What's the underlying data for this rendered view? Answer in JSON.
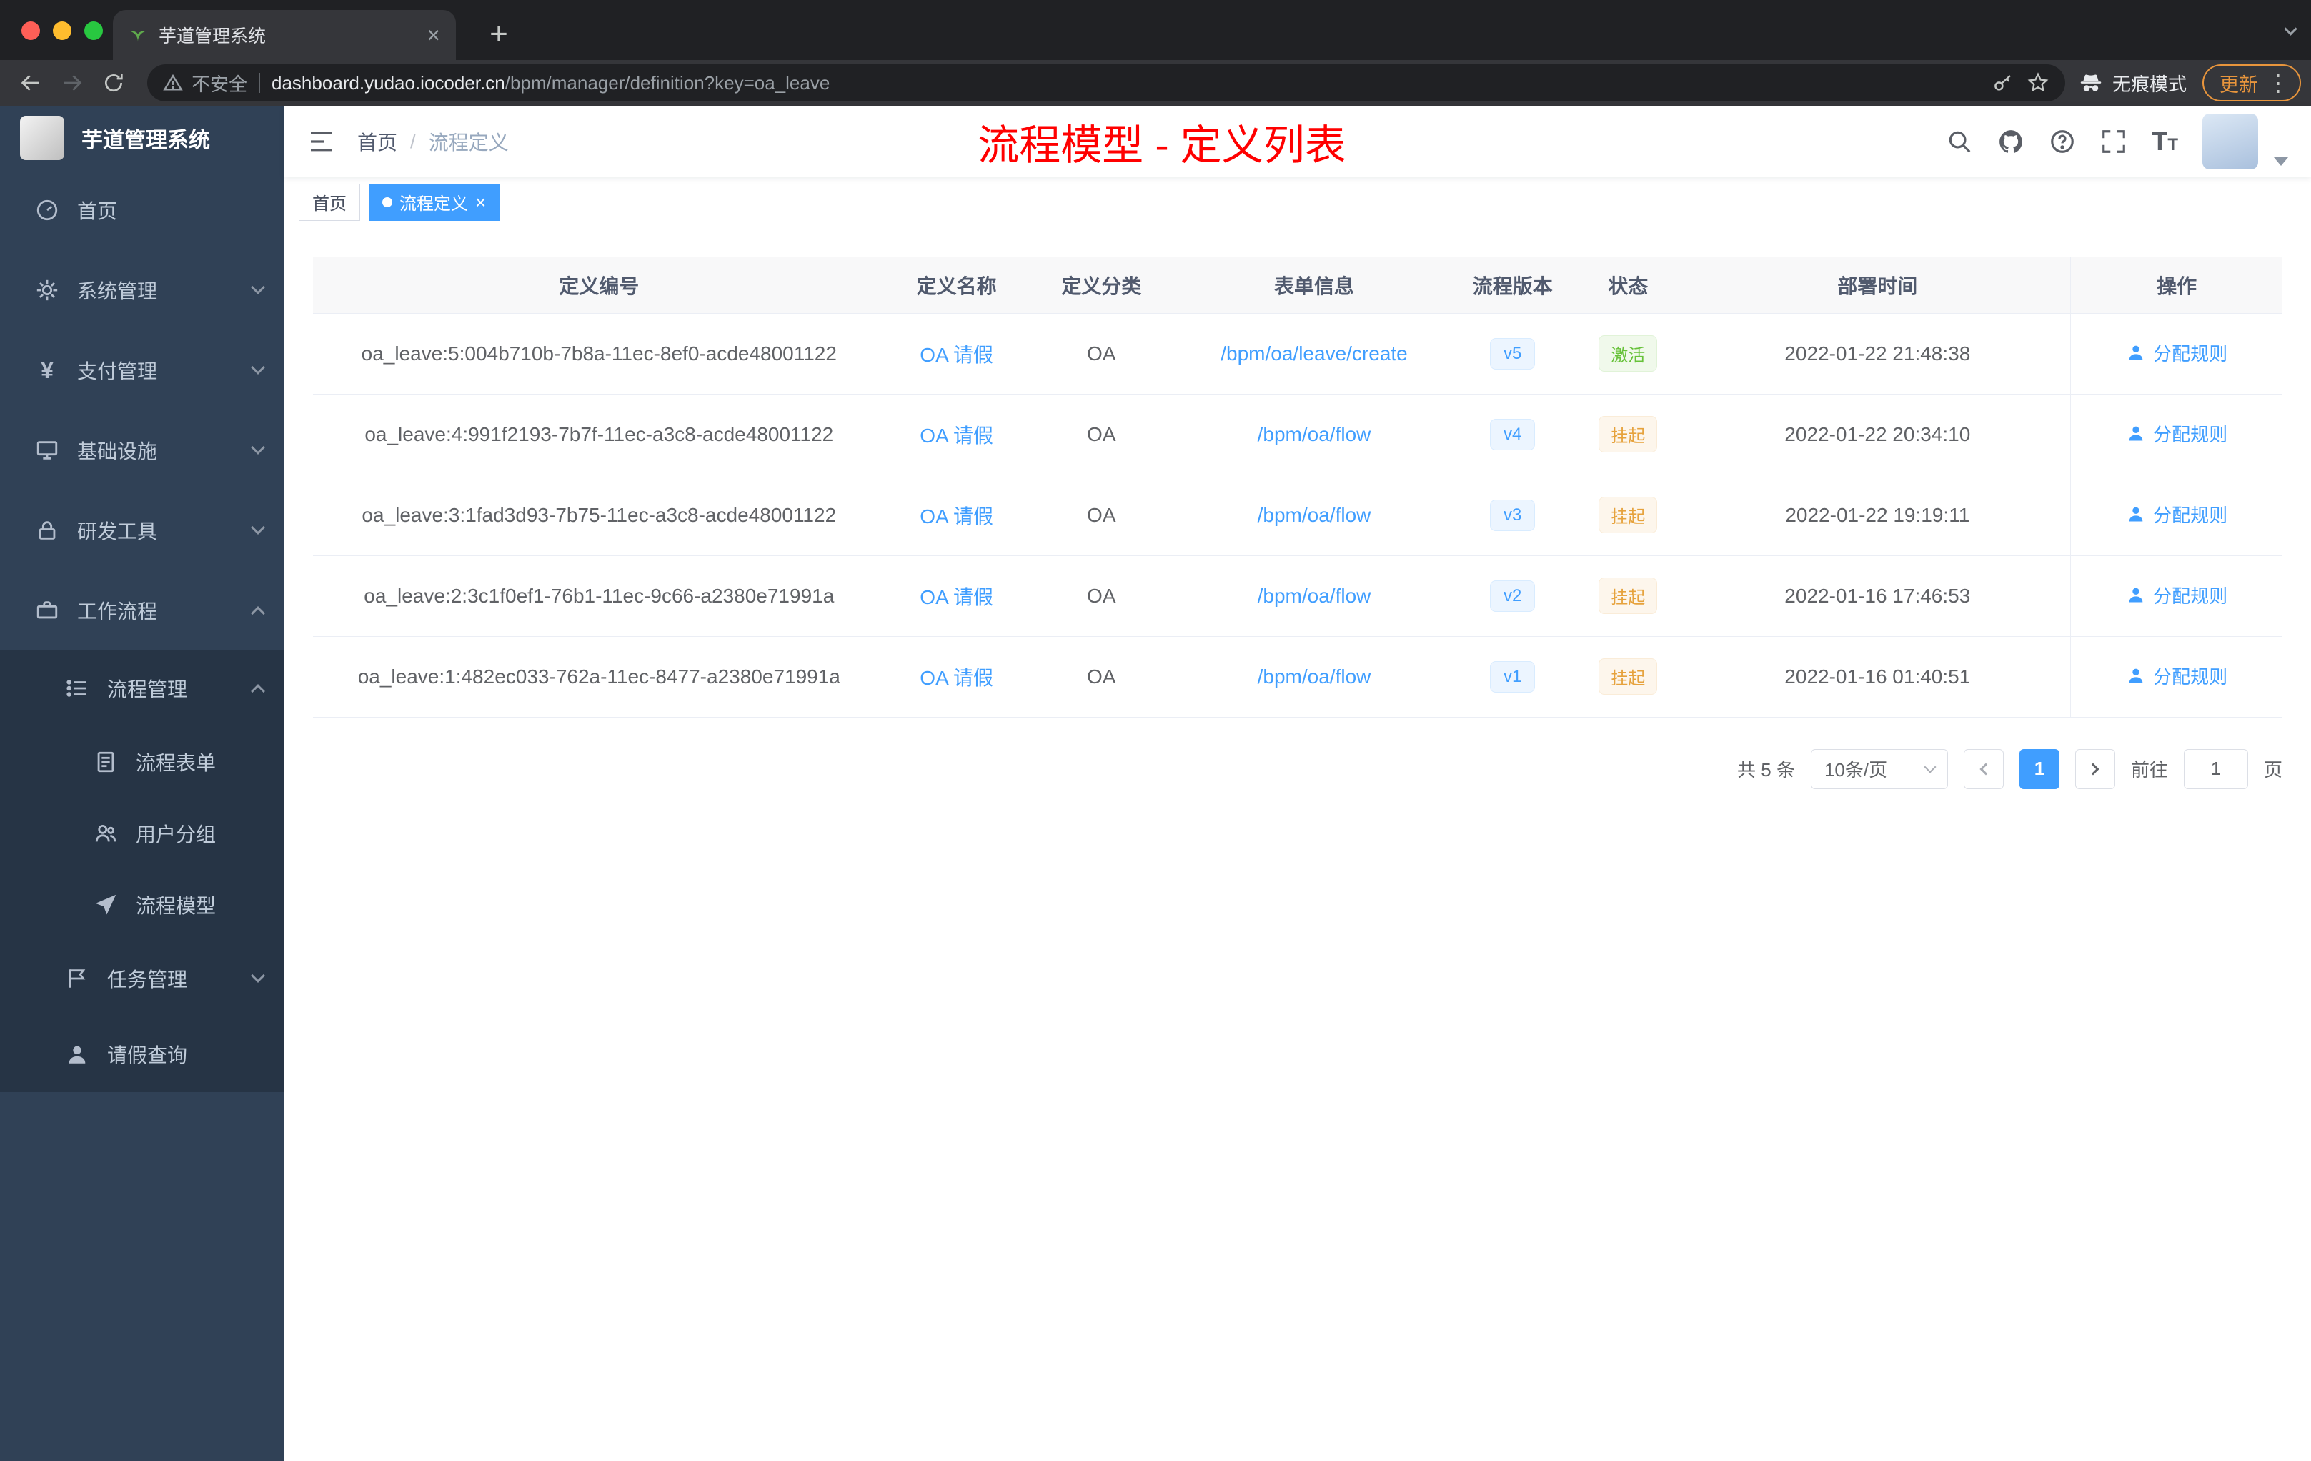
{
  "colors": {
    "accent": "#409eff",
    "annotation": "#ff0000",
    "status_active_text": "#67c23a",
    "status_suspended_text": "#e6a23c",
    "sidebar_bg": "#304156",
    "submenu_bg": "#263445"
  },
  "browser": {
    "tab_title": "芋道管理系统",
    "close_tab_glyph": "×",
    "new_tab_glyph": "+",
    "security_label": "不安全",
    "url_domain": "dashboard.yudao.iocoder.cn",
    "url_path": "/bpm/manager/definition?key=oa_leave",
    "incognito_label": "无痕模式",
    "update_label": "更新",
    "menu_dots_glyph": "⋮"
  },
  "sidebar": {
    "app_title": "芋道管理系统",
    "items": [
      {
        "label": "首页",
        "icon": "gauge-icon"
      },
      {
        "label": "系统管理",
        "icon": "gear-icon"
      },
      {
        "label": "支付管理",
        "icon": "yen-icon"
      },
      {
        "label": "基础设施",
        "icon": "monitor-icon"
      },
      {
        "label": "研发工具",
        "icon": "lock-icon"
      },
      {
        "label": "工作流程",
        "icon": "briefcase-icon"
      },
      {
        "label": "流程管理",
        "icon": "list-icon"
      },
      {
        "label": "流程表单",
        "icon": "document-icon"
      },
      {
        "label": "用户分组",
        "icon": "people-icon"
      },
      {
        "label": "流程模型",
        "icon": "paper-plane-icon"
      },
      {
        "label": "任务管理",
        "icon": "flag-icon"
      },
      {
        "label": "请假查询",
        "icon": "person-icon"
      }
    ]
  },
  "navbar": {
    "breadcrumb_home": "首页",
    "breadcrumb_separator": "/",
    "breadcrumb_current": "流程定义",
    "annotation": "流程模型 - 定义列表"
  },
  "tags": {
    "home_label": "首页",
    "active_label": "流程定义",
    "close_glyph": "×"
  },
  "table": {
    "columns": [
      "定义编号",
      "定义名称",
      "定义分类",
      "表单信息",
      "流程版本",
      "状态",
      "部署时间",
      "操作"
    ],
    "rows": [
      {
        "id": "oa_leave:5:004b710b-7b8a-11ec-8ef0-acde48001122",
        "name": "OA 请假",
        "category": "OA",
        "form": "/bpm/oa/leave/create",
        "version": "v5",
        "status": "激活",
        "time": "2022-01-22 21:48:38",
        "action": "分配规则"
      },
      {
        "id": "oa_leave:4:991f2193-7b7f-11ec-a3c8-acde48001122",
        "name": "OA 请假",
        "category": "OA",
        "form": "/bpm/oa/flow",
        "version": "v4",
        "status": "挂起",
        "time": "2022-01-22 20:34:10",
        "action": "分配规则"
      },
      {
        "id": "oa_leave:3:1fad3d93-7b75-11ec-a3c8-acde48001122",
        "name": "OA 请假",
        "category": "OA",
        "form": "/bpm/oa/flow",
        "version": "v3",
        "status": "挂起",
        "time": "2022-01-22 19:19:11",
        "action": "分配规则"
      },
      {
        "id": "oa_leave:2:3c1f0ef1-76b1-11ec-9c66-a2380e71991a",
        "name": "OA 请假",
        "category": "OA",
        "form": "/bpm/oa/flow",
        "version": "v2",
        "status": "挂起",
        "time": "2022-01-16 17:46:53",
        "action": "分配规则"
      },
      {
        "id": "oa_leave:1:482ec033-762a-11ec-8477-a2380e71991a",
        "name": "OA 请假",
        "category": "OA",
        "form": "/bpm/oa/flow",
        "version": "v1",
        "status": "挂起",
        "time": "2022-01-16 01:40:51",
        "action": "分配规则"
      }
    ]
  },
  "pagination": {
    "total": "共 5 条",
    "page_size": "10条/页",
    "current_page": "1",
    "goto_prefix": "前往",
    "goto_value": "1",
    "goto_suffix": "页"
  }
}
